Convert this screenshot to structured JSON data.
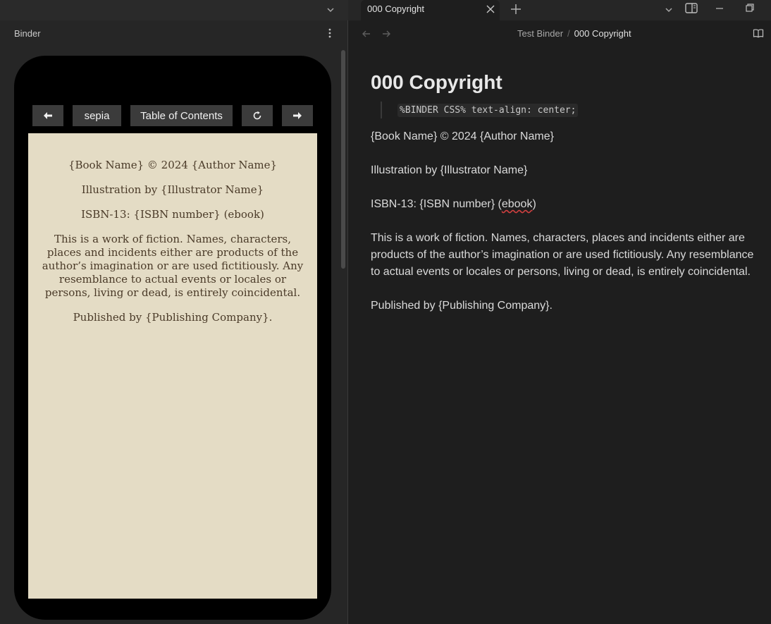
{
  "titlebar": {
    "tab_title": "000 Copyright"
  },
  "binder": {
    "label": "Binder"
  },
  "reader_toolbar": {
    "prev_symbol": "🠸",
    "theme_label": "sepia",
    "toc_label": "Table of Contents",
    "refresh_symbol": "↻",
    "next_symbol": "🠺"
  },
  "reader_page": {
    "line1": "{Book Name} © 2024 {Author Name}",
    "line2": "Illustration by {Illustrator Name}",
    "line3": "ISBN-13: {ISBN number} (ebook)",
    "line4": "This is a work of fiction. Names, characters, places and incidents either are products of the author’s imagination or are used fictitiously. Any resemblance to actual events or locales or persons, living or dead, is entirely coincidental.",
    "line5": "Published by {Publishing Company}."
  },
  "breadcrumb": {
    "parent": "Test Binder",
    "separator": "/",
    "current": "000 Copyright"
  },
  "document": {
    "title": "000 Copyright",
    "code": "%BINDER CSS% text-align: center;",
    "p1": "{Book Name} © 2024 {Author Name}",
    "p2": "Illustration by {Illustrator Name}",
    "p3_prefix": "ISBN-13: {ISBN number} (",
    "p3_word": "ebook",
    "p3_suffix": ")",
    "p4": "This is a work of fiction. Names, characters, places and incidents either are products of the author’s imagination or are used fictitiously. Any resemblance to actual events or locales or persons, living or dead, is entirely coincidental.",
    "p5": "Published by {Publishing Company}."
  },
  "colors": {
    "sepia_page": "#e4dcc5",
    "sepia_text": "#4a3a28",
    "editor_bg": "#1e1e1e",
    "sidebar_bg": "#262626",
    "spellcheck": "#d04040"
  }
}
